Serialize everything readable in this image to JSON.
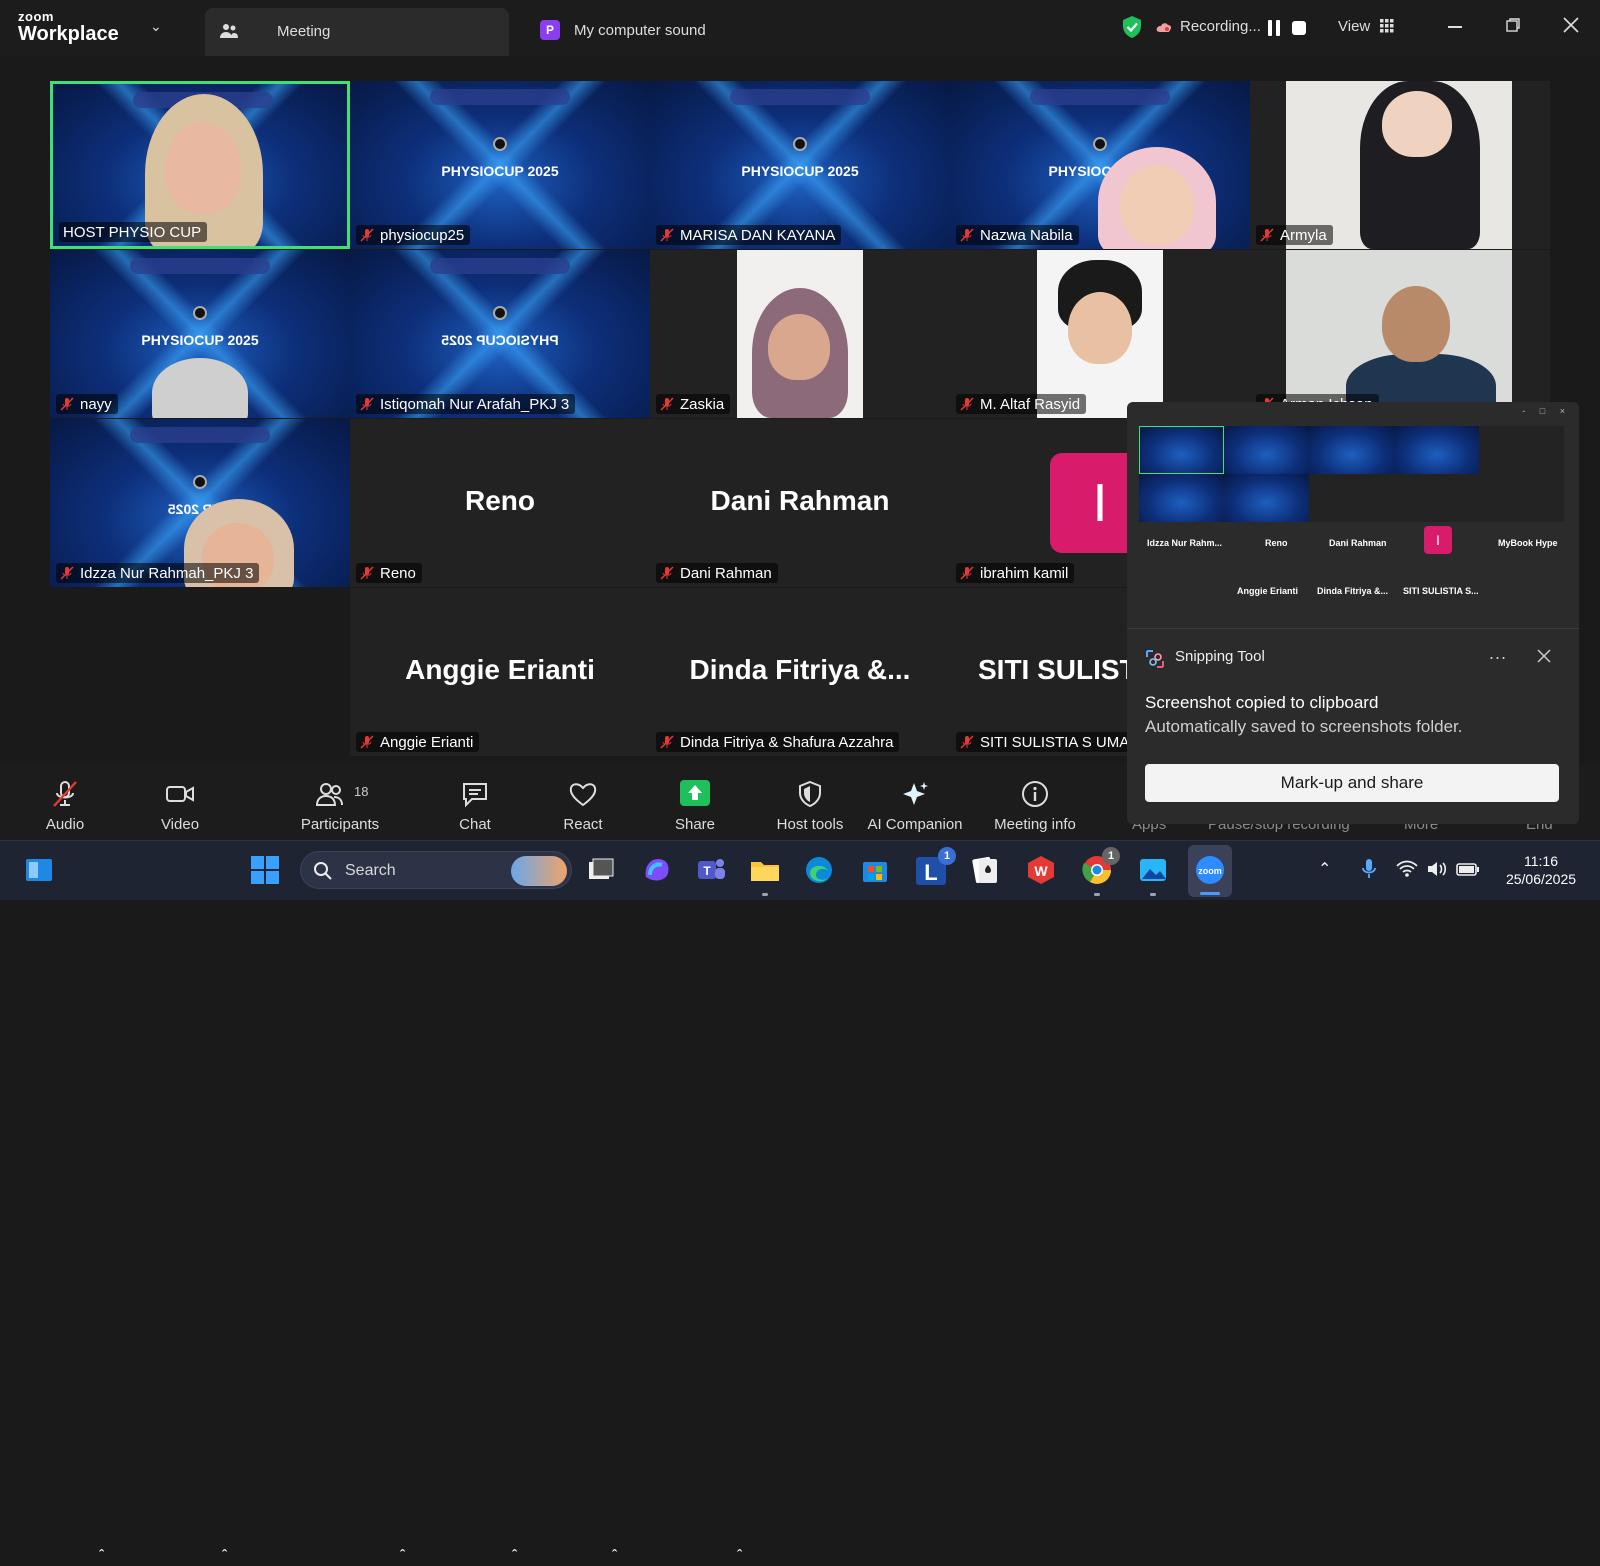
{
  "titlebar": {
    "brand_top": "zoom",
    "brand_bottom": "Workplace",
    "tab_meeting": "Meeting",
    "tab_sound_badge": "P",
    "tab_sound": "My computer sound",
    "recording": "Recording...",
    "view": "View"
  },
  "colors": {
    "active_speaker": "#3ee07a",
    "share_green": "#1fbf5c",
    "avatar_pink": "#d81b6a"
  },
  "tiles": [
    {
      "name": "HOST PHYSIO CUP",
      "kind": "video"
    },
    {
      "name": "physiocup25",
      "kind": "virtual_bg",
      "bg_text": "PHYSIOCUP 2025"
    },
    {
      "name": "MARISA DAN KAYANA",
      "kind": "virtual_bg",
      "bg_text": "PHYSIOCUP 2025"
    },
    {
      "name": "Nazwa Nabila",
      "kind": "virtual_bg",
      "bg_text": "PHYSIOC"
    },
    {
      "name": "Armyla",
      "kind": "video"
    },
    {
      "name": "nayy",
      "kind": "virtual_bg",
      "bg_text": "PHYSIOCUP 2025"
    },
    {
      "name": "Istiqomah Nur Arafah_PKJ 3",
      "kind": "virtual_bg",
      "bg_text": "PHYSIOCUP 2025"
    },
    {
      "name": "Zaskia",
      "kind": "video"
    },
    {
      "name": "M. Altaf Rasyid",
      "kind": "video"
    },
    {
      "name": "Arman Ichsan",
      "kind": "video"
    },
    {
      "name": "Idzza Nur Rahmah_PKJ 3",
      "kind": "virtual_bg",
      "bg_text": "CUP 2025"
    },
    {
      "name": "Reno",
      "kind": "name_only",
      "big": "Reno"
    },
    {
      "name": "Dani Rahman",
      "kind": "name_only",
      "big": "Dani Rahman"
    },
    {
      "name": "ibrahim kamil",
      "kind": "avatar",
      "initial": "I"
    },
    {
      "name": "Anggie Erianti",
      "kind": "name_only",
      "big": "Anggie Erianti"
    },
    {
      "name": "Dinda Fitriya & Shafura Azzahra",
      "kind": "name_only",
      "big": "Dinda Fitriya &..."
    },
    {
      "name": "SITI SULISTIA S UMAR",
      "kind": "name_only",
      "big": "SITI SULISTIA S..."
    }
  ],
  "mini_window": {
    "labels": [
      "Idzza Nur Rahm...",
      "Reno",
      "Dani Rahman",
      "MyBook Hype",
      "Anggie Erianti",
      "Dinda Fitriya &...",
      "SITI SULISTIA S..."
    ],
    "avatar_initial": "I"
  },
  "toast": {
    "app": "Snipping Tool",
    "more": "...",
    "title": "Screenshot copied to clipboard",
    "body": "Automatically saved to screenshots folder.",
    "action": "Mark-up and share"
  },
  "toolbar": {
    "audio": "Audio",
    "video": "Video",
    "participants": "Participants",
    "participants_count": "18",
    "chat": "Chat",
    "react": "React",
    "share": "Share",
    "host_tools": "Host tools",
    "ai_companion": "AI Companion",
    "meeting_info": "Meeting info",
    "apps": "Apps",
    "pause_stop": "Pause/stop recording",
    "more": "More",
    "end": "End"
  },
  "taskbar": {
    "search": "Search",
    "time": "11:16",
    "date": "25/06/2025",
    "teams_badge": "1",
    "chrome_badge": "1"
  }
}
